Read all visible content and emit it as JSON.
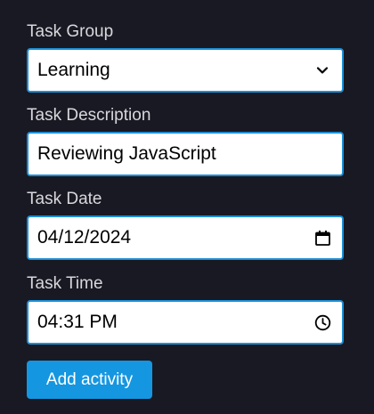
{
  "form": {
    "group": {
      "label": "Task Group",
      "value": "Learning"
    },
    "description": {
      "label": "Task Description",
      "value": "Reviewing JavaScript"
    },
    "date": {
      "label": "Task Date",
      "value": "04/12/2024"
    },
    "time": {
      "label": "Task Time",
      "value": "04:31 PM"
    },
    "submit_label": "Add activity"
  },
  "icons": {
    "group_trail": "chevron-down-icon",
    "date_trail": "calendar-icon",
    "time_trail": "clock-icon"
  },
  "colors": {
    "background": "#191923",
    "label_text": "#d7d7dc",
    "field_border": "#1c8fd6",
    "button": "#1596e0"
  }
}
